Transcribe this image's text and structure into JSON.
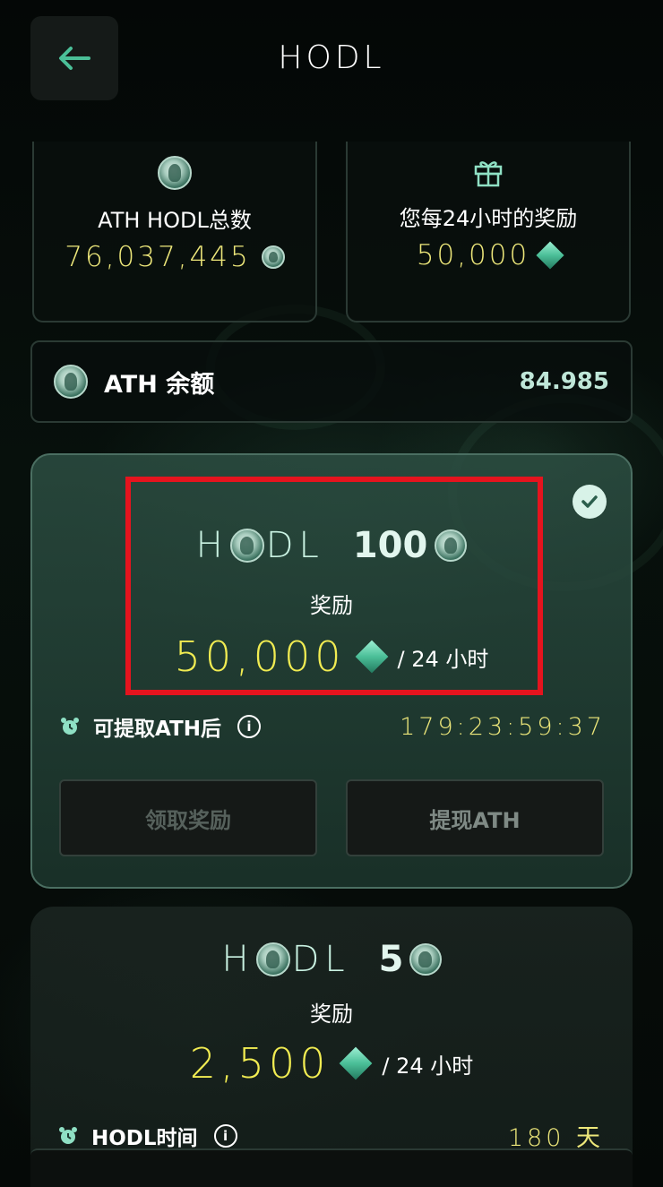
{
  "header": {
    "title": "HODL",
    "back_icon": "arrow-left-icon"
  },
  "stats": {
    "total": {
      "label": "ATH HODL总数",
      "value": "76,037,445"
    },
    "daily_reward": {
      "label": "您每24小时的奖励",
      "value": "50,000"
    }
  },
  "balance": {
    "label": "ATH 余额",
    "value": "84.985"
  },
  "plan_selected": {
    "hodl_word_left": "H",
    "hodl_word_right": "DL",
    "amount": "100",
    "reward_label": "奖励",
    "reward_value": "50,000",
    "reward_unit": "/ 24 小时",
    "timer_label": "可提取ATH后",
    "timer_value": "179:23:59:37",
    "claim_button": "领取奖励",
    "withdraw_button": "提现ATH",
    "selected": true
  },
  "plan_second": {
    "hodl_word_left": "H",
    "hodl_word_right": "DL",
    "amount": "5",
    "reward_label": "奖励",
    "reward_value": "2,500",
    "reward_unit": "/ 24 小时",
    "duration_label": "HODL时间",
    "duration_value": "180 天"
  },
  "colors": {
    "accent_green": "#4bbf98",
    "gold": "#f1ec52",
    "highlight_red": "#e5141e"
  }
}
